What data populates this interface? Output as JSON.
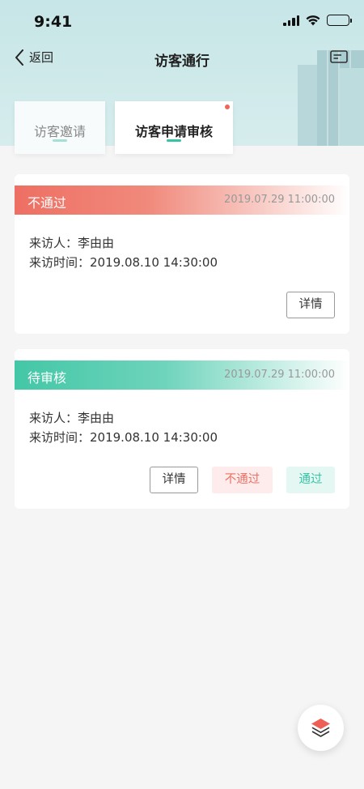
{
  "status_bar": {
    "time": "9:41"
  },
  "nav": {
    "back_label": "返回",
    "title": "访客通行"
  },
  "tabs": [
    {
      "label": "访客邀请"
    },
    {
      "label": "访客申请审核"
    }
  ],
  "cards": [
    {
      "status": "不通过",
      "timestamp": "2019.07.29 11:00:00",
      "visitor": "来访人：李由由",
      "visit_time": "来访时间：2019.08.10  14:30:00",
      "detail_label": "详情"
    },
    {
      "status": "待审核",
      "timestamp": "2019.07.29 11:00:00",
      "visitor": "来访人：李由由",
      "visit_time": "来访时间：2019.08.10  14:30:00",
      "detail_label": "详情",
      "reject_label": "不通过",
      "pass_label": "通过"
    }
  ],
  "colors": {
    "accent_green": "#36c3a6",
    "reject_red": "#ee6f63",
    "background": "#f5f5f5"
  },
  "icons": {
    "back": "chevron-left-icon",
    "card": "id-card-icon",
    "fab": "layers-icon"
  }
}
